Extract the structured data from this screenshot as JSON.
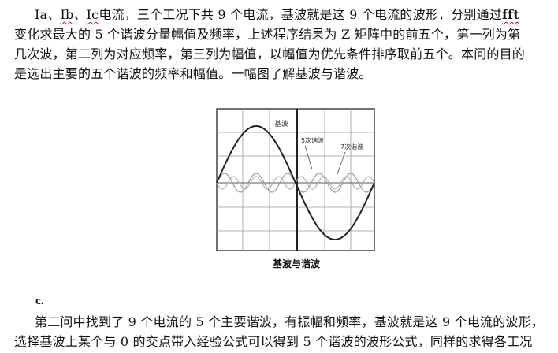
{
  "paragraph1": {
    "line1_pre": "Ia、",
    "line1_ib": "Ib",
    "line1_sep": "、",
    "line1_ic": "Ic",
    "line1_mid": "电流，三个工况下共 9 个电流，基波就是这 9 个电流的波形，分别通过",
    "line1_fft": "fft",
    "line2": "变化求最大的 5 个谐波分量幅值及频率，上述程序结果为 Z 矩阵中的前五个，第一列为第",
    "line3": "几次波，第二列为对应频率，第三列为幅值，以幅值为优先条件排序取前五个。本问的目的",
    "line4": "是选出主要的五个谐波的频率和幅值。一幅图了解基波与谐波。"
  },
  "figure": {
    "label_fundamental": "基波",
    "label_5th": "5次谐波",
    "label_7th": "7次谐波",
    "caption": "基波与谐波"
  },
  "section_c": "c.",
  "paragraph2": {
    "line1": "第二问中找到了 9 个电流的 5 个主要谐波，有振幅和频率，基波就是这 9 个电流的波形，",
    "line2": "选择基波上某个与 0 的交点带入经验公式可以得到 5 个谐波的波形公式，同样的求得各工况"
  }
}
